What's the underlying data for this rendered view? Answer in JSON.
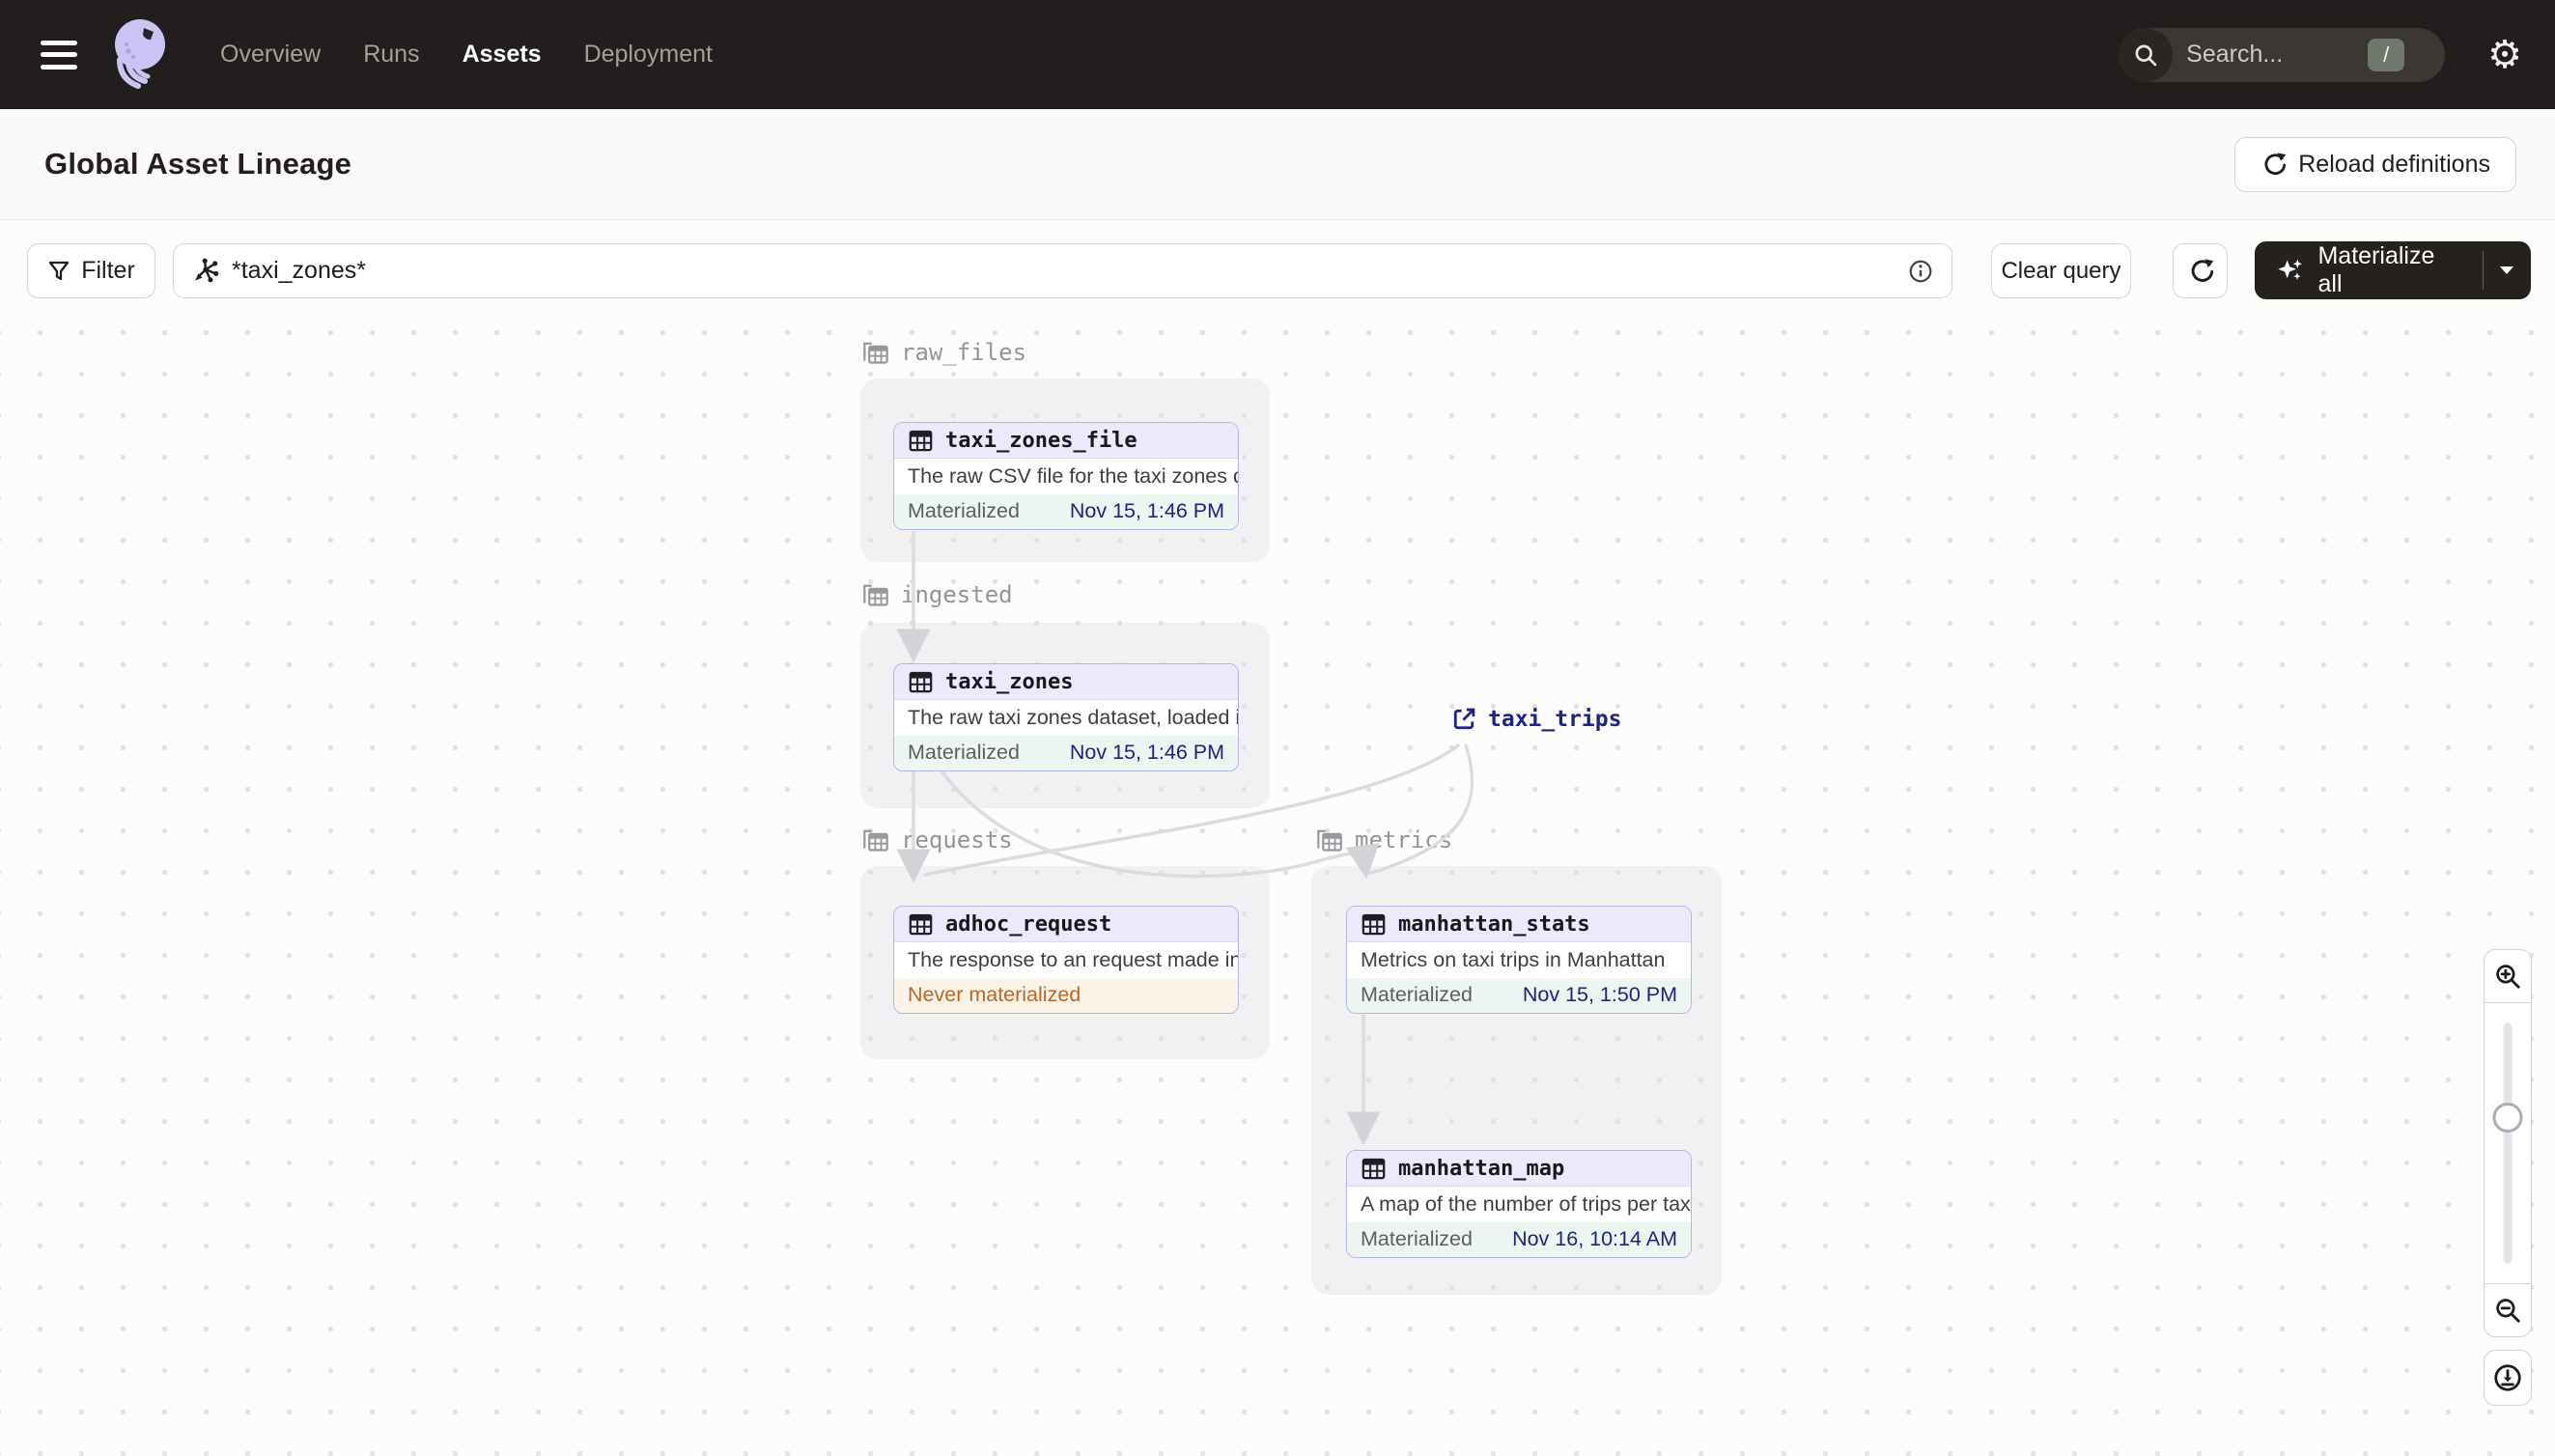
{
  "topbar": {
    "nav": [
      {
        "label": "Overview",
        "active": false
      },
      {
        "label": "Runs",
        "active": false
      },
      {
        "label": "Assets",
        "active": true
      },
      {
        "label": "Deployment",
        "active": false
      }
    ],
    "search": {
      "placeholder": "Search...",
      "shortcut": "/"
    }
  },
  "header": {
    "title": "Global Asset Lineage",
    "reload_label": "Reload definitions"
  },
  "toolbar": {
    "filter_label": "Filter",
    "query_value": "*taxi_zones*",
    "clear_label": "Clear query",
    "materialize_label": "Materialize all"
  },
  "graph": {
    "groups": [
      {
        "name": "raw_files"
      },
      {
        "name": "ingested"
      },
      {
        "name": "requests"
      },
      {
        "name": "metrics"
      }
    ],
    "nodes": [
      {
        "title": "taxi_zones_file",
        "description": "The raw CSV file for the taxi zones dat...",
        "status": "Materialized",
        "timestamp": "Nov 15, 1:46 PM"
      },
      {
        "title": "taxi_zones",
        "description": "The raw taxi zones dataset, loaded int...",
        "status": "Materialized",
        "timestamp": "Nov 15, 1:46 PM"
      },
      {
        "title": "adhoc_request",
        "description": "The response to an request made in th...",
        "status": "Never materialized",
        "timestamp": ""
      },
      {
        "title": "manhattan_stats",
        "description": "Metrics on taxi trips in Manhattan",
        "status": "Materialized",
        "timestamp": "Nov 15, 1:50 PM"
      },
      {
        "title": "manhattan_map",
        "description": "A map of the number of trips per taxi z...",
        "status": "Materialized",
        "timestamp": "Nov 16, 10:14 AM"
      }
    ],
    "external": {
      "label": "taxi_trips"
    }
  },
  "colors": {
    "topbar_bg": "#211E1D",
    "node_border": "#B7B3EB",
    "node_header_bg": "#ECEAFA",
    "materialized_bg": "#EDF5F0",
    "timestamp_navy": "#1D2483",
    "never_materialized_text": "#B5692B",
    "never_materialized_bg": "#FAF2E6",
    "edge": "#DCDCE0"
  }
}
